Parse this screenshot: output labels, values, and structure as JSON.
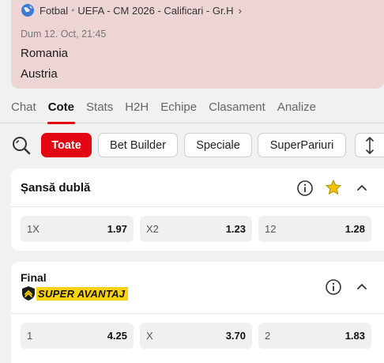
{
  "match": {
    "breadcrumb": [
      "Fotbal",
      "UEFA - CM 2026 - Calificari - Gr.H"
    ],
    "datetime": "Dum 12. Oct, 21:45",
    "home": "Romania",
    "away": "Austria"
  },
  "tabs": [
    {
      "label": "Chat",
      "active": false
    },
    {
      "label": "Cote",
      "active": true
    },
    {
      "label": "Stats",
      "active": false
    },
    {
      "label": "H2H",
      "active": false
    },
    {
      "label": "Echipe",
      "active": false
    },
    {
      "label": "Clasament",
      "active": false
    },
    {
      "label": "Analize",
      "active": false
    }
  ],
  "filters": {
    "items": [
      "Toate",
      "Bet Builder",
      "Speciale",
      "SuperPariuri"
    ],
    "active": "Toate"
  },
  "markets": [
    {
      "title": "Șansă dublă",
      "odds": [
        {
          "label": "1X",
          "value": "1.97"
        },
        {
          "label": "X2",
          "value": "1.23"
        },
        {
          "label": "12",
          "value": "1.28"
        }
      ]
    },
    {
      "title": "Final",
      "badge": "SUPER AVANTAJ",
      "odds": [
        {
          "label": "1",
          "value": "4.25"
        },
        {
          "label": "X",
          "value": "3.70"
        },
        {
          "label": "2",
          "value": "1.83"
        }
      ]
    }
  ],
  "colors": {
    "accent": "#e30613",
    "hero_bg": "#eed5d5",
    "star": "#f2c200",
    "badge": "#fbd20f"
  }
}
